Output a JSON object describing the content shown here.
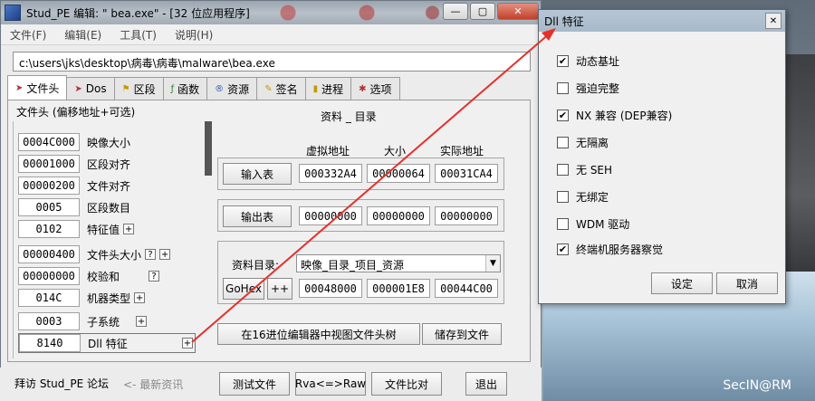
{
  "window": {
    "title": "Stud_PE 编辑: \"   bea.exe\" - [32 位应用程序]",
    "buttons": {
      "minimize": "—",
      "maximize": "▢",
      "close": "✕"
    }
  },
  "menu": [
    "文件(F)",
    "编辑(E)",
    "工具(T)",
    "说明(H)"
  ],
  "path": "c:\\users\\jks\\desktop\\病毒\\病毒\\malware\\bea.exe",
  "tabs": [
    "文件头",
    "Dos",
    "区段",
    "函数",
    "资源",
    "签名",
    "进程",
    "选项"
  ],
  "header_list": {
    "title": "文件头 (偏移地址+可选)",
    "rows": [
      {
        "value": "0004C000",
        "label": "映像大小"
      },
      {
        "value": "00001000",
        "label": "区段对齐"
      },
      {
        "value": "00000200",
        "label": "文件对齐"
      },
      {
        "value": "0005",
        "label": "区段数目"
      },
      {
        "value": "0102",
        "label": "特征值"
      },
      {
        "value": "00000400",
        "label": "文件头大小"
      },
      {
        "value": "00000000",
        "label": "校验和"
      },
      {
        "value": "014C",
        "label": "机器类型"
      },
      {
        "value": "0003",
        "label": "子系统"
      },
      {
        "value": "8140",
        "label": "Dll 特征"
      }
    ]
  },
  "data_dir": {
    "title": "资料 _ 目录",
    "headers": [
      "虚拟地址",
      "大小",
      "实际地址"
    ],
    "import": {
      "button": "输入表",
      "values": [
        "000332A4",
        "00000064",
        "00031CA4"
      ]
    },
    "export": {
      "button": "输出表",
      "values": [
        "00000000",
        "00000000",
        "00000000"
      ]
    },
    "dir_label": "资料目录:",
    "dir_select": "映像_目录_项目_资源",
    "goto_button": "GoHex",
    "plus_button": "++",
    "dir_values": [
      "00048000",
      "000001E8",
      "00044C00"
    ],
    "hex_view_button": "在16进位编辑器中视图文件头树",
    "save_button": "储存到文件"
  },
  "status_bar": {
    "forum": "拜访 Stud_PE 论坛",
    "news": "<- 最新资讯",
    "test_file": "测试文件",
    "rva_raw": "Rva<=>Raw",
    "compare": "文件比对",
    "exit": "退出"
  },
  "dialog": {
    "title": "Dll 特征",
    "options": [
      {
        "label": "动态基址",
        "checked": true
      },
      {
        "label": "强迫完整",
        "checked": false
      },
      {
        "label": "NX 兼容 (DEP兼容)",
        "checked": true
      },
      {
        "label": "无隔离",
        "checked": false
      },
      {
        "label": "无 SEH",
        "checked": false
      },
      {
        "label": "无绑定",
        "checked": false
      },
      {
        "label": "WDM 驱动",
        "checked": false
      },
      {
        "label": "终端机服务器察觉",
        "checked": true
      }
    ],
    "ok": "设定",
    "cancel": "取消"
  },
  "watermark": "SecIN@RM",
  "colors": {
    "arrow": "#e5302a"
  }
}
